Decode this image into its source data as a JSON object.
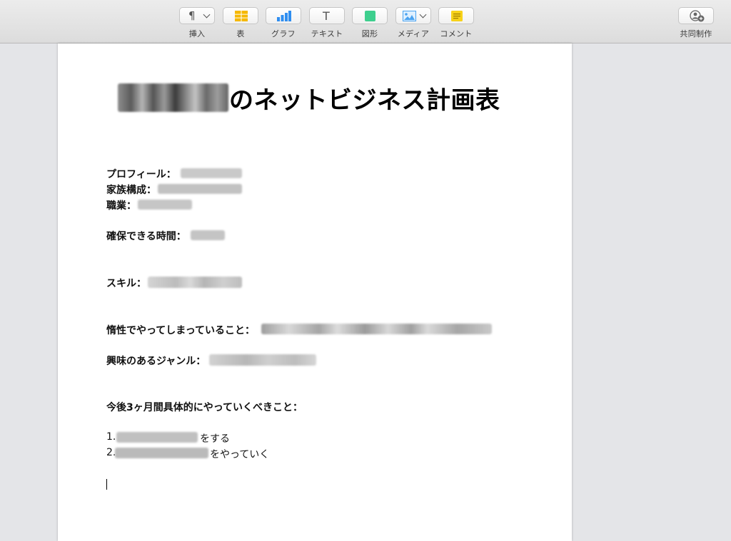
{
  "toolbar": {
    "items": [
      {
        "label": "挿入",
        "icon": "paragraph-icon"
      },
      {
        "label": "表",
        "icon": "table-icon"
      },
      {
        "label": "グラフ",
        "icon": "chart-icon"
      },
      {
        "label": "テキスト",
        "icon": "text-icon"
      },
      {
        "label": "図形",
        "icon": "shape-icon"
      },
      {
        "label": "メディア",
        "icon": "media-icon"
      },
      {
        "label": "コメント",
        "icon": "comment-icon"
      }
    ],
    "collaborate_label": "共同制作",
    "paragraph_glyph": "¶",
    "text_glyph": "T"
  },
  "colors": {
    "table_icon": "#f5b800",
    "chart_icon": "#2f8ef0",
    "shape_icon": "#3ecf8e",
    "media_icon": "#4aa3f0",
    "comment_icon": "#f7d21a"
  },
  "document": {
    "title": "のネットビジネス計画表",
    "profile_label": "プロフィール：",
    "family_label": "家族構成：",
    "job_label": "職業：",
    "time_label": "確保できる時間：",
    "skill_label": "スキル：",
    "habit_label": "惰性でやってしまっていること：",
    "interest_label": "興味のあるジャンル：",
    "plan_heading": "今後3ヶ月間具体的にやっていくべきこと：",
    "plan_item1_prefix": "1.",
    "plan_item1_suffix": "をする",
    "plan_item2_prefix": "2.",
    "plan_item2_suffix": "をやっていく"
  }
}
